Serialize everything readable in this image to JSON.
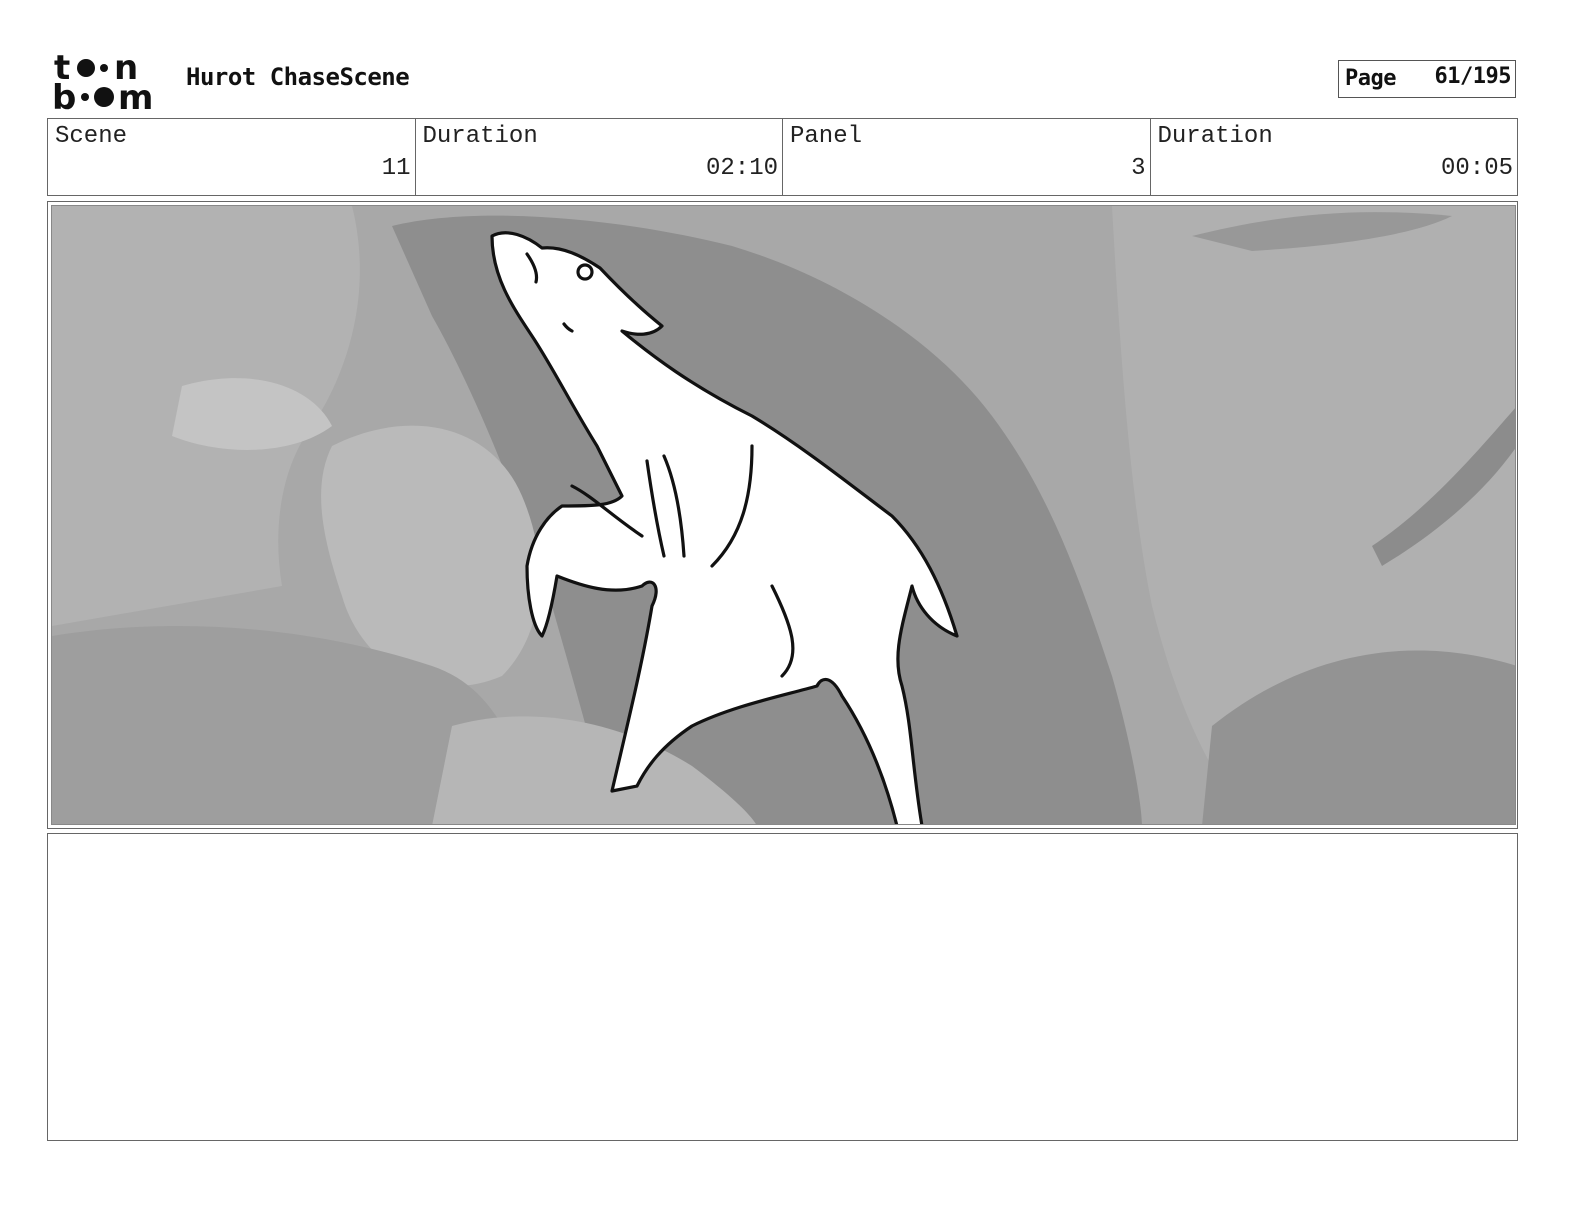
{
  "header": {
    "logo_text": [
      "t",
      "n",
      "b",
      "m"
    ],
    "title": "Hurot ChaseScene",
    "page_label": "Page",
    "page_number": "61/195"
  },
  "info": {
    "scene_label": "Scene",
    "scene_value": "11",
    "scene_duration_label": "Duration",
    "scene_duration_value": "02:10",
    "panel_label": "Panel",
    "panel_value": "3",
    "panel_duration_label": "Duration",
    "panel_duration_value": "00:05"
  },
  "panel_art": {
    "subject": "deer-sketch",
    "palette": {
      "background": "#a8a8a8",
      "light": "#b8b8b8",
      "dark": "#8e8e8e",
      "ink": "#111111",
      "figure": "#ffffff"
    }
  },
  "notes": {
    "text": ""
  }
}
